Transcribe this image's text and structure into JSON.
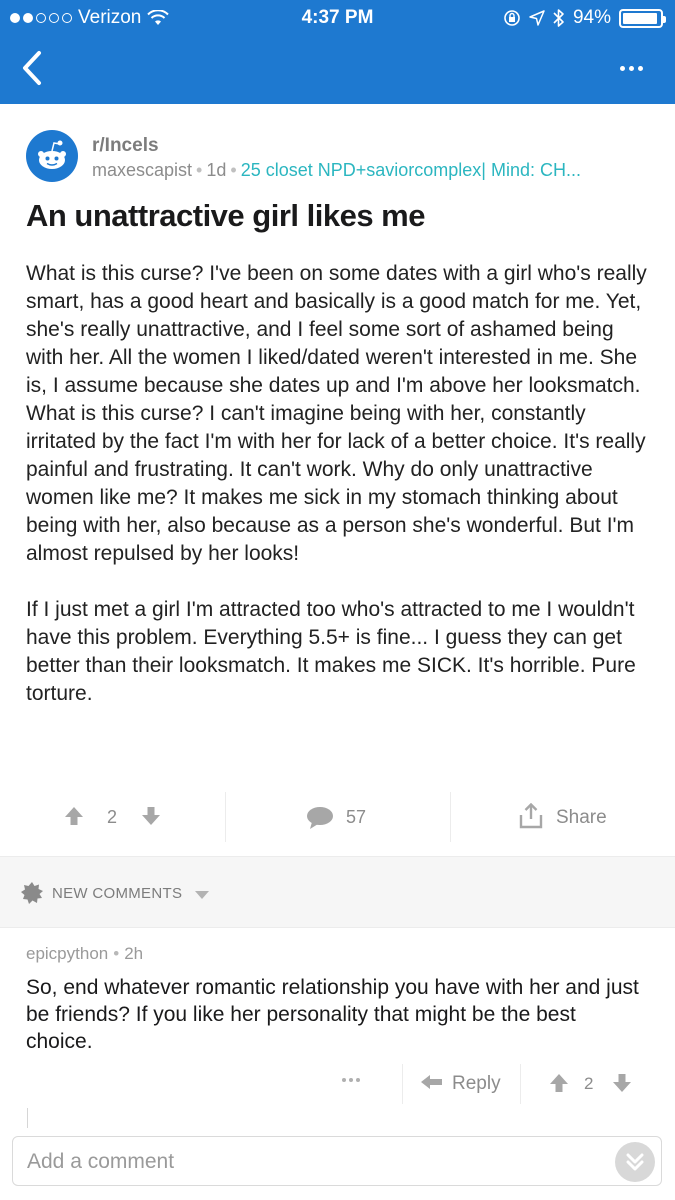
{
  "status_bar": {
    "carrier": "Verizon",
    "time": "4:37 PM",
    "battery": "94%",
    "battery_level": 0.94,
    "signal_bars_filled": 2,
    "signal_bars_total": 5
  },
  "nav": {
    "back_icon": "chevron-left-icon",
    "more_icon": "more-horizontal-icon"
  },
  "post": {
    "subreddit": "r/Incels",
    "author": "maxescapist",
    "age": "1d",
    "flair": "25 closet NPD+saviorcomplex| Mind: CH...",
    "title": "An unattractive girl likes me",
    "body": [
      "What is this curse? I've been on some dates with a girl who's really smart, has a good heart and basically is a good match for me. Yet, she's really unattractive, and I feel some sort of ashamed being with her. All the women I liked/dated weren't interested in me. She is, I assume because she dates up and I'm above her looksmatch. What is this curse? I can't imagine being with her, constantly irritated by the fact I'm with her for lack of a better choice. It's really painful and frustrating. It can't work. Why do only unattractive women like me? It makes me sick in my stomach thinking about being with her, also because as a person she's wonderful. But I'm almost repulsed by her looks!",
      "If I just met a girl I'm attracted too who's attracted to me I wouldn't have this problem. Everything 5.5+ is fine... I guess they can get better than their looksmatch. It makes me SICK. It's horrible. Pure torture."
    ],
    "score": "2",
    "comment_count": "57",
    "share_label": "Share"
  },
  "comments_sort": {
    "label": "NEW COMMENTS"
  },
  "comments": [
    {
      "author": "epicpython",
      "age": "2h",
      "body": "So, end whatever romantic relationship you have with her and just be friends? If you like her personality that might be the best choice.",
      "reply_label": "Reply",
      "score": "2"
    }
  ],
  "composer": {
    "placeholder": "Add a comment"
  },
  "colors": {
    "header_blue": "#1e79d0",
    "flair_teal": "#2bb6c0",
    "muted_gray": "#8c8c8c"
  }
}
